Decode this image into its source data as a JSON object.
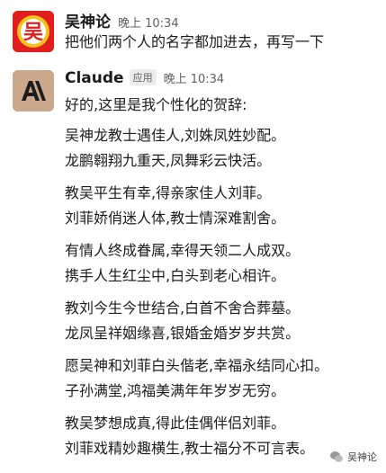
{
  "messages": {
    "user": {
      "avatar_text": "吴",
      "sender": "吴神论",
      "time": "晚上 10:34",
      "text": "把他们两个人的名字都加进去，再写一下"
    },
    "claude": {
      "sender": "Claude",
      "badge": "应用",
      "time": "晚上 10:34",
      "intro": "好的,这里是我个性化的贺辞:",
      "stanzas": [
        [
          "吴神龙教士遇佳人,刘姝凤姓妙配。",
          "龙鹏翱翔九重天,凤舞彩云快活。"
        ],
        [
          "教吴平生有幸,得亲家佳人刘菲。",
          "刘菲娇俏迷人体,教士情深难割舍。"
        ],
        [
          "有情人终成眷属,幸得天领二人成双。",
          "携手人生红尘中,白头到老心相许。"
        ],
        [
          "教刘今生今世结合,白首不舍合葬墓。",
          "龙凤呈祥姻缘喜,银婚金婚岁岁共赏。"
        ],
        [
          "愿吴神和刘菲白头偕老,幸福永结同心扣。",
          "子孙满堂,鸿福美满年年岁岁无穷。"
        ],
        [
          "教吴梦想成真,得此佳偶伴侣刘菲。",
          "刘菲戏精妙趣横生,教士福分不可言表。"
        ]
      ]
    }
  },
  "watermark": {
    "text": "吴神论"
  },
  "colors": {
    "user_avatar_bg": "#e01e1e",
    "claude_avatar_bg": "#c9a88c",
    "text": "#1d1c1d",
    "muted": "#616061"
  }
}
